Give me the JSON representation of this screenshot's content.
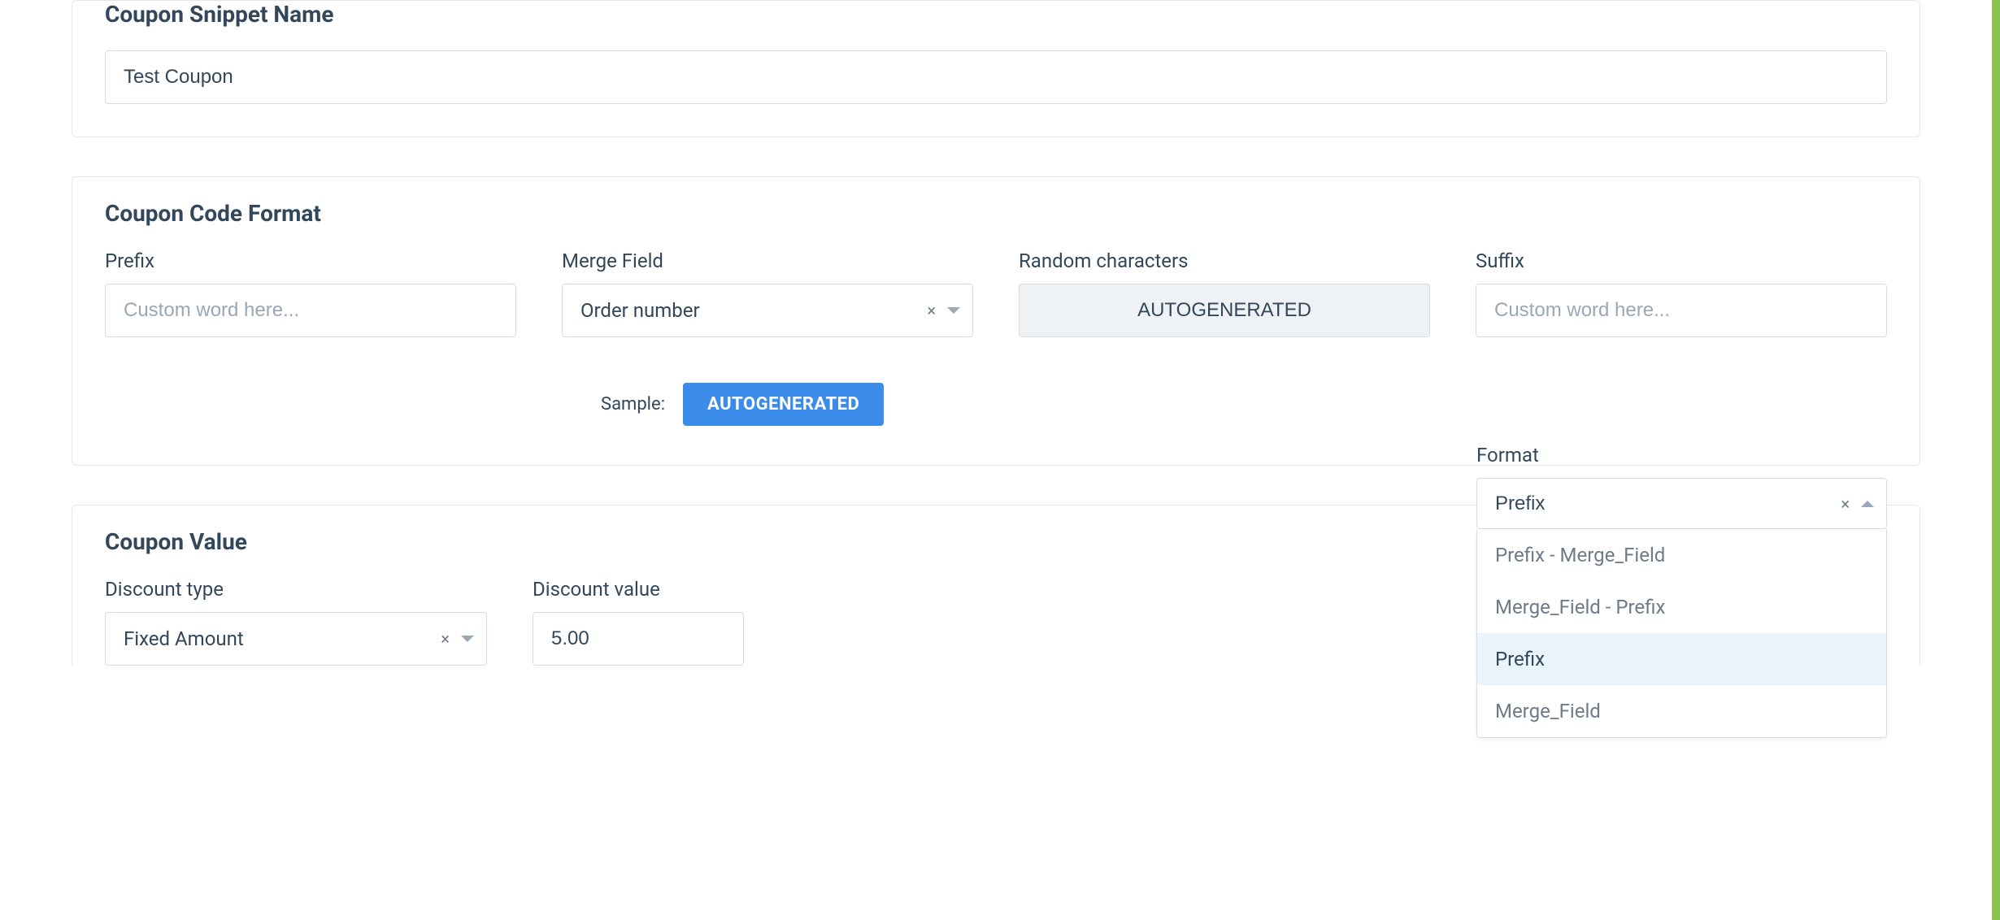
{
  "snippet": {
    "section_title": "Coupon Snippet Name",
    "value": "Test Coupon"
  },
  "code_format": {
    "section_title": "Coupon Code Format",
    "prefix": {
      "label": "Prefix",
      "placeholder": "Custom word here...",
      "value": ""
    },
    "merge_field": {
      "label": "Merge Field",
      "value": "Order number"
    },
    "random": {
      "label": "Random characters",
      "value": "AUTOGENERATED"
    },
    "suffix": {
      "label": "Suffix",
      "placeholder": "Custom word here...",
      "value": ""
    },
    "sample": {
      "label": "Sample:",
      "value": "AUTOGENERATED"
    },
    "format": {
      "label": "Format",
      "value": "Prefix",
      "options": [
        "Prefix - Merge_Field",
        "Merge_Field - Prefix",
        "Prefix",
        "Merge_Field"
      ]
    }
  },
  "coupon_value": {
    "section_title": "Coupon Value",
    "discount_type": {
      "label": "Discount type",
      "value": "Fixed Amount"
    },
    "discount_value": {
      "label": "Discount value",
      "value": "5.00"
    }
  }
}
